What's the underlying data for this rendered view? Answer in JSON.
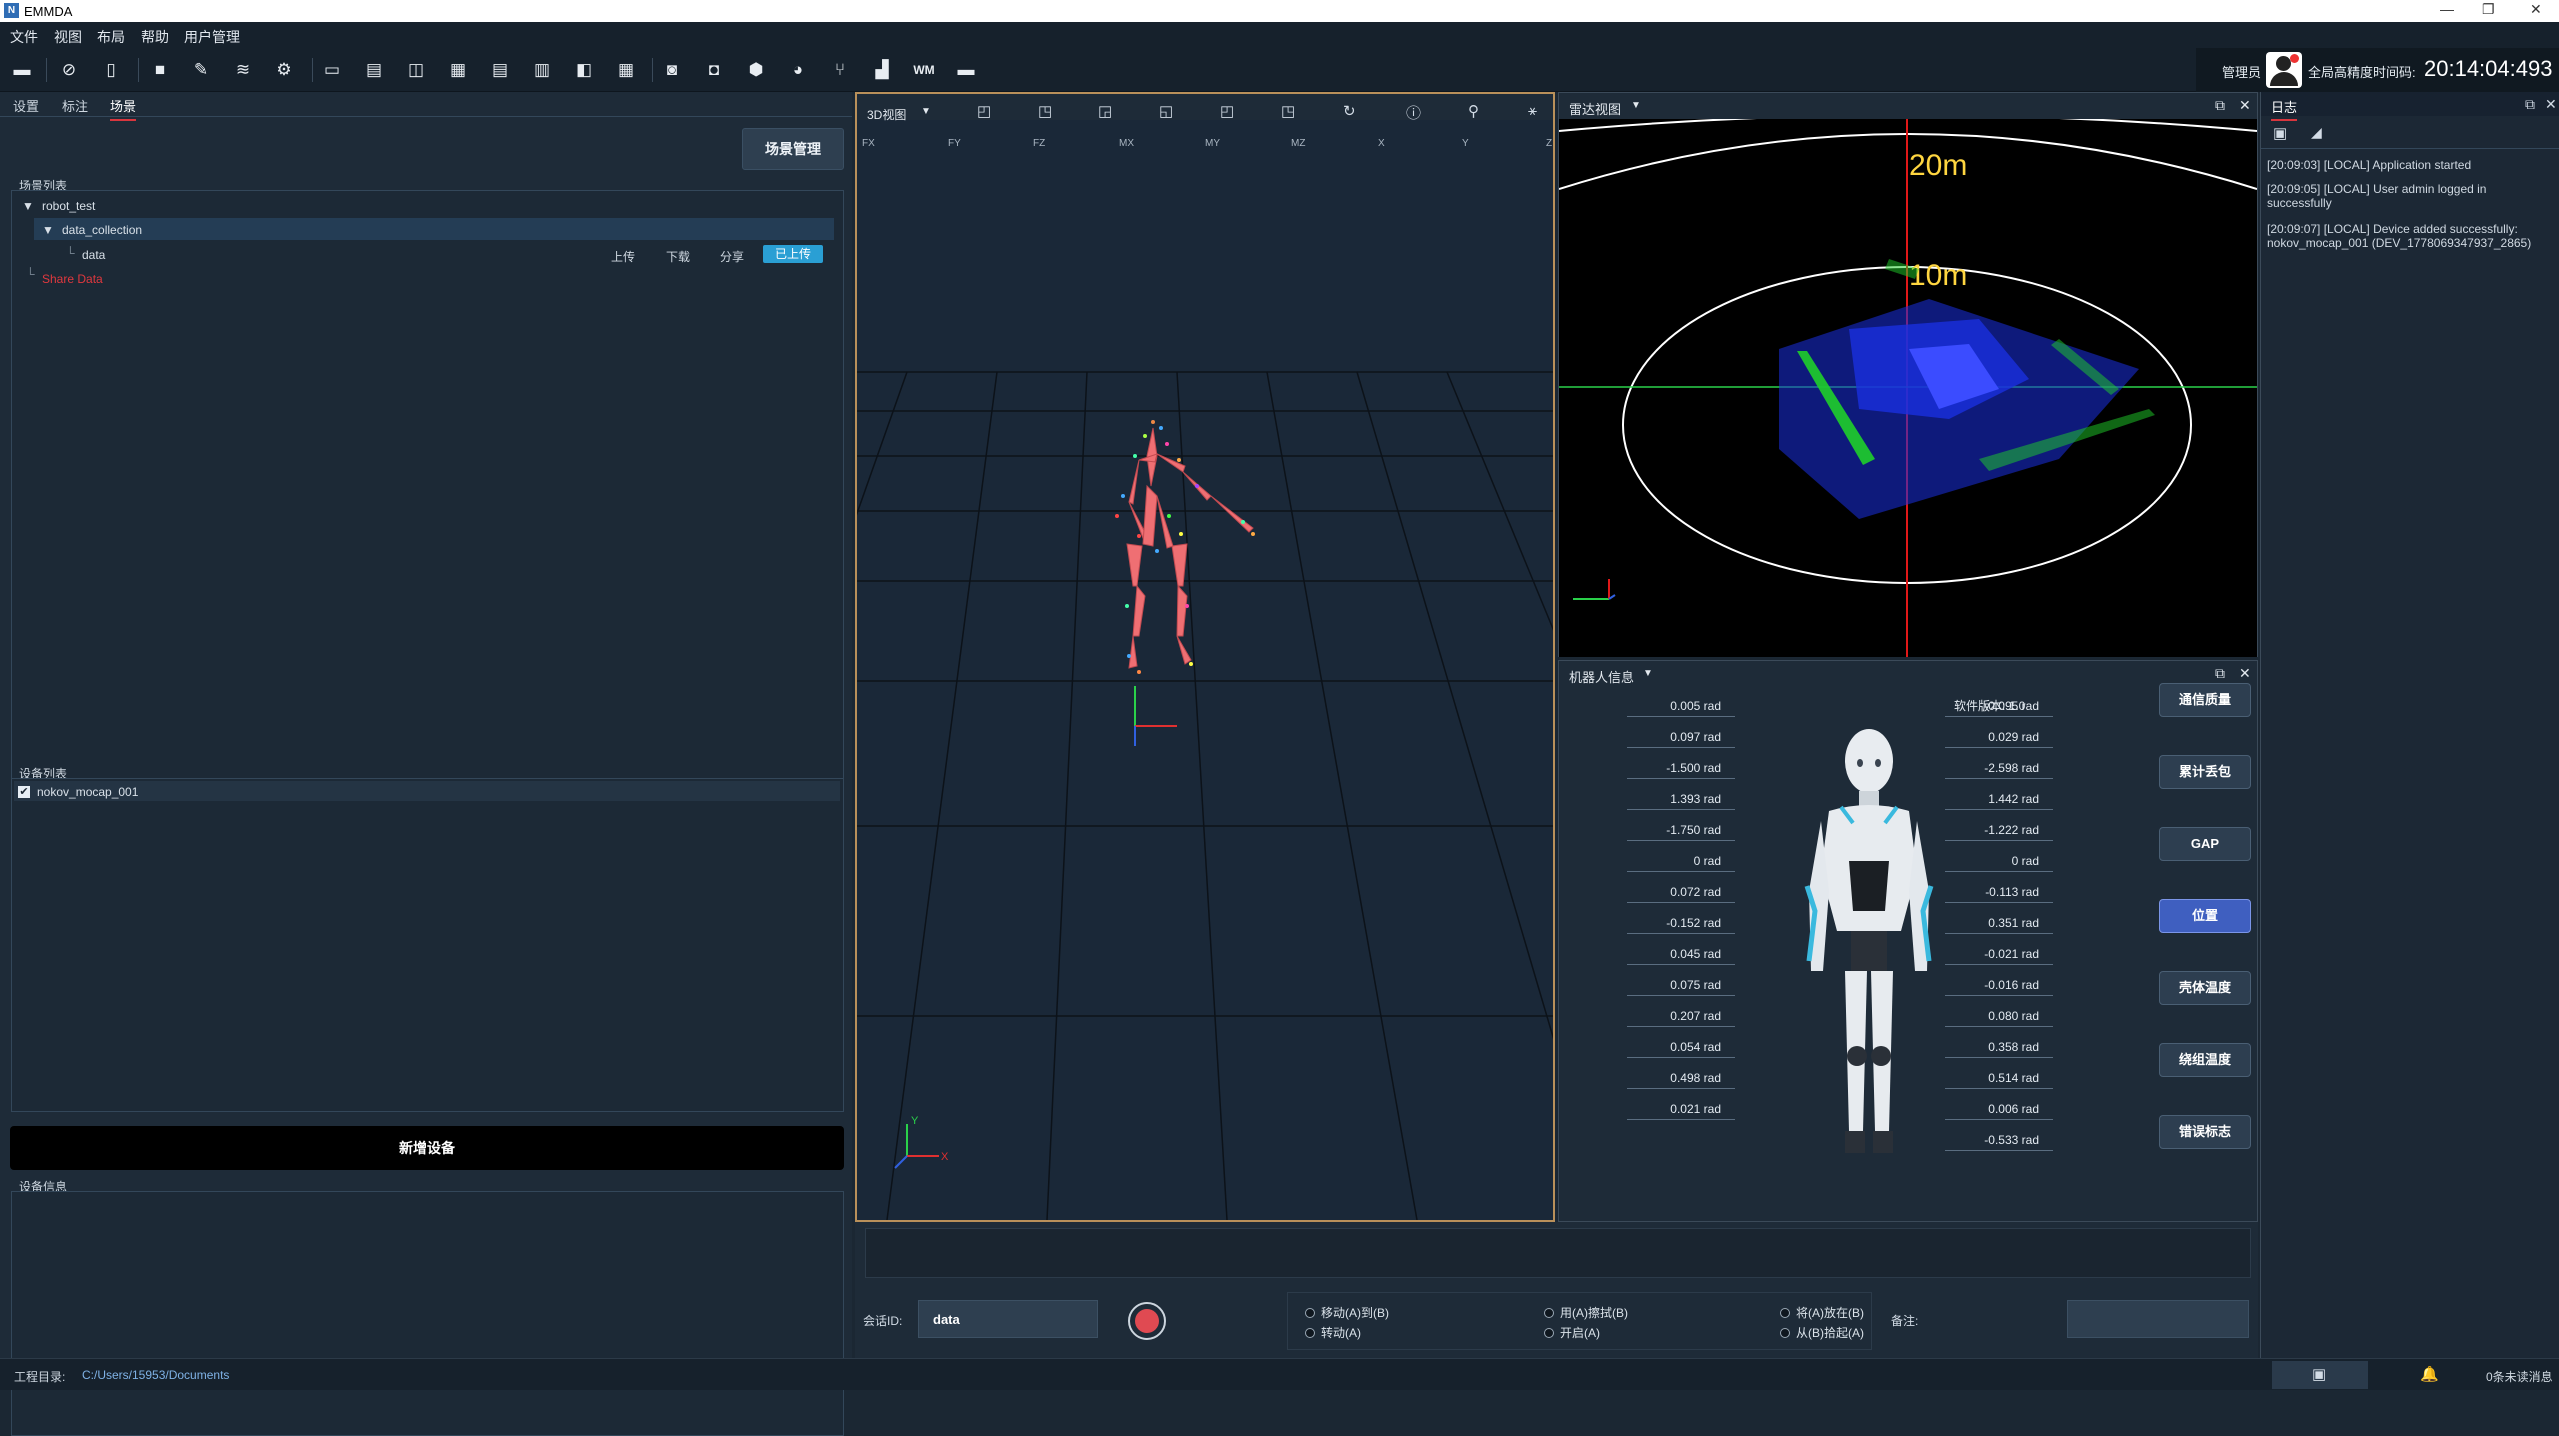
{
  "window": {
    "title": "EMMDA",
    "logo": "N"
  },
  "menu": [
    "文件",
    "视图",
    "布局",
    "帮助",
    "用户管理"
  ],
  "toolbar_icons": [
    "open-folder-icon",
    "hide-icon",
    "phone-icon",
    "camera-x-icon",
    "pen-icon",
    "layers-icon",
    "gear-icon",
    "layout-1-icon",
    "layout-2-icon",
    "layout-3-icon",
    "layout-4-icon",
    "layout-5-icon",
    "layout-6-icon",
    "layout-7-icon",
    "layout-8-icon",
    "capture-icon",
    "camera-icon",
    "box-icon",
    "gauge-icon",
    "branch-icon",
    "bar-chart-icon",
    "wm-icon",
    "file-icon"
  ],
  "user": {
    "role": "管理员",
    "time_label": "全局高精度时间码:",
    "time": "20:14:04:493"
  },
  "left": {
    "tabs": [
      "设置",
      "标注",
      "场景"
    ],
    "scene_manage_btn": "场景管理",
    "scene_list_title": "场景列表",
    "tree": {
      "root": "robot_test",
      "child": "data_collection",
      "leaf": "data",
      "share": "Share Data",
      "actions": [
        "上传",
        "下载",
        "分享"
      ],
      "uploaded": "已上传"
    },
    "device_list_title": "设备列表",
    "device": "nokov_mocap_001",
    "add_device_btn": "新增设备",
    "device_info_title": "设备信息"
  },
  "viewer": {
    "view_select": "3D视图",
    "columns": [
      "FX",
      "FY",
      "FZ",
      "MX",
      "MY",
      "MZ",
      "X",
      "Y",
      "Z"
    ],
    "axis": {
      "y": "Y",
      "x": "X"
    }
  },
  "radar": {
    "view_select": "雷达视图",
    "ring_near": "10m",
    "ring_far": "20m"
  },
  "robot": {
    "view_select": "机器人信息",
    "version": "软件版本: 1.0",
    "left_joints": [
      "0.005 rad",
      "0.097 rad",
      "-1.500 rad",
      "1.393 rad",
      "-1.750 rad",
      "0 rad",
      "0.072 rad",
      "-0.152 rad",
      "0.045 rad",
      "0.075 rad",
      "0.207 rad",
      "0.054 rad",
      "0.498 rad",
      "0.021 rad"
    ],
    "right_joints": [
      "-0.095 rad",
      "0.029 rad",
      "-2.598 rad",
      "1.442 rad",
      "-1.222 rad",
      "0 rad",
      "-0.113 rad",
      "0.351 rad",
      "-0.021 rad",
      "-0.016 rad",
      "0.080 rad",
      "0.358 rad",
      "0.514 rad",
      "0.006 rad",
      "-0.533 rad"
    ],
    "buttons": [
      "通信质量",
      "累计丢包",
      "GAP",
      "位置",
      "壳体温度",
      "绕组温度",
      "错误标志"
    ],
    "active_button": "位置"
  },
  "log": {
    "title": "日志",
    "lines": [
      "[20:09:03] [LOCAL] Application started",
      "[20:09:05] [LOCAL] User admin logged in successfully",
      "[20:09:07] [LOCAL] Device added successfully: nokov_mocap_001 (DEV_1778069347937_2865)"
    ]
  },
  "bottom": {
    "session_label": "会话ID:",
    "session_value": "data",
    "radios": [
      "移动(A)到(B)",
      "转动(A)",
      "用(A)擦拭(B)",
      "开启(A)",
      "将(A)放在(B)",
      "从(B)拾起(A)"
    ],
    "note_label": "备注:"
  },
  "status": {
    "dir_label": "工程目录:",
    "dir": "C:/Users/15953/Documents",
    "messages": "0条未读消息"
  }
}
